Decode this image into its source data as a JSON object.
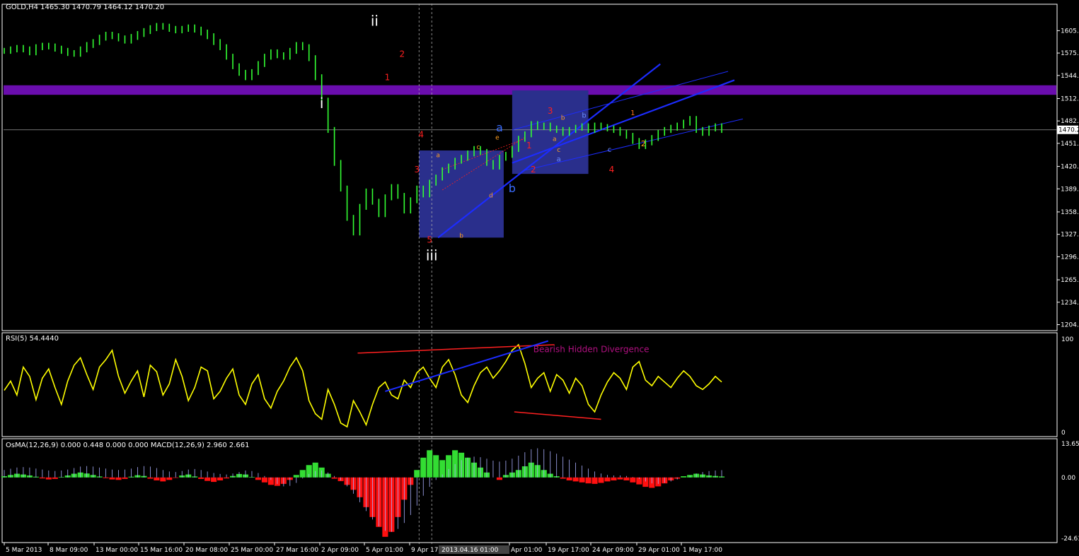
{
  "header": {
    "main": "GOLD,H4  1465.30 1470.79 1464.12 1470.20",
    "rsi": "RSI(5) 54.4440",
    "macd": "OsMA(12,26,9) 0.000 0.448 0.000 0.000  MACD(12,26,9) 2.960 2.661"
  },
  "colors": {
    "background": "#000000",
    "candle": "#33ff33",
    "zone": "#6a0dad",
    "box": "#2a2f8c",
    "channel": "#1c2cff",
    "rsi": "#ffff00",
    "divergence": "#ff2020",
    "divergence_text": "#b01080",
    "hist_up": "#33dd33",
    "hist_down": "#ff1010",
    "macd_line": "#aab0ff"
  },
  "chart_data": [
    {
      "type": "line",
      "panel": "price",
      "title": "GOLD,H4",
      "ohlc_last": {
        "open": 1465.3,
        "high": 1470.79,
        "low": 1464.12,
        "close": 1470.2
      },
      "yticks": [
        1605.6,
        1575.0,
        1544.4,
        1512.9,
        1482.3,
        1451.7,
        1420.2,
        1389.6,
        1358.1,
        1327.5,
        1296.9,
        1265.4,
        1234.8,
        1204.2
      ],
      "ylim": [
        1196,
        1632
      ],
      "current_price": "1470.2",
      "x": [
        0,
        3,
        6,
        9,
        12,
        15,
        18,
        21,
        24,
        27,
        30,
        33,
        36,
        39,
        42,
        45,
        48,
        51,
        54,
        57,
        60,
        63,
        66,
        69,
        72,
        75,
        78,
        81,
        84,
        87,
        90,
        93,
        96,
        99,
        102,
        105,
        108,
        111,
        114,
        117,
        120,
        123,
        126,
        129,
        132,
        135,
        138,
        141,
        144,
        147,
        150,
        153,
        156,
        159,
        162,
        165,
        168,
        171,
        174,
        177,
        180,
        183,
        186,
        189,
        192,
        195,
        198,
        201,
        204,
        207,
        210,
        213,
        216,
        219,
        222,
        225,
        228,
        231,
        234,
        237,
        240,
        243,
        246,
        249,
        252,
        255,
        258,
        261,
        264,
        267,
        270,
        273,
        276,
        279,
        282,
        285,
        288,
        291,
        294,
        297,
        300,
        303,
        306,
        309,
        312,
        315,
        318,
        321,
        324,
        327,
        330,
        333,
        336,
        339
      ],
      "y": [
        1578,
        1580,
        1582,
        1580,
        1576,
        1583,
        1585,
        1584,
        1581,
        1578,
        1575,
        1574,
        1580,
        1586,
        1590,
        1596,
        1600,
        1598,
        1595,
        1592,
        1597,
        1601,
        1605,
        1609,
        1612,
        1611,
        1608,
        1606,
        1608,
        1610,
        1607,
        1603,
        1598,
        1590,
        1583,
        1570,
        1557,
        1548,
        1542,
        1549,
        1560,
        1570,
        1576,
        1572,
        1570,
        1578,
        1586,
        1583,
        1568,
        1542,
        1510,
        1470,
        1425,
        1390,
        1350,
        1330,
        1365,
        1386,
        1372,
        1355,
        1378,
        1392,
        1380,
        1360,
        1374,
        1390,
        1382,
        1398,
        1405,
        1415,
        1420,
        1428,
        1432,
        1438,
        1444,
        1440,
        1425,
        1420,
        1432,
        1436,
        1444,
        1458,
        1464,
        1478,
        1474,
        1476,
        1472,
        1470,
        1466,
        1470,
        1473,
        1475,
        1470,
        1476,
        1474,
        1472,
        1470,
        1466,
        1462,
        1455,
        1448,
        1453,
        1459,
        1466,
        1470,
        1473,
        1476,
        1480,
        1485,
        1470,
        1466,
        1472,
        1475,
        1470
      ],
      "annotations": [
        "i",
        "ii",
        "iii",
        "1",
        "2",
        "3",
        "4",
        "5",
        "a",
        "b",
        "c",
        "d",
        "e"
      ],
      "xticks": [
        "5 Mar 2013",
        "8 Mar 09:00",
        "13 Mar 00:00",
        "15 Mar 16:00",
        "20 Mar 08:00",
        "25 Mar 00:00",
        "27 Mar 16:00",
        "2 Apr 09:00",
        "5 Apr 01:00",
        "9 Apr 17:00",
        "Apr 01:00",
        "19 Apr 17:00",
        "24 Apr 09:00",
        "29 Apr 01:00",
        "1 May 17:00"
      ],
      "cursor_time": "2013.04.16 01:00"
    },
    {
      "type": "line",
      "panel": "rsi",
      "title": "RSI(5) 54.4440",
      "yticks": [
        "100",
        "0"
      ],
      "ylim": [
        0,
        100
      ],
      "x": [
        0,
        3,
        6,
        9,
        12,
        15,
        18,
        21,
        24,
        27,
        30,
        33,
        36,
        39,
        42,
        45,
        48,
        51,
        54,
        57,
        60,
        63,
        66,
        69,
        72,
        75,
        78,
        81,
        84,
        87,
        90,
        93,
        96,
        99,
        102,
        105,
        108,
        111,
        114,
        117,
        120,
        123,
        126,
        129,
        132,
        135,
        138,
        141,
        144,
        147,
        150,
        153,
        156,
        159,
        162,
        165,
        168,
        171,
        174,
        177,
        180,
        183,
        186,
        189,
        192,
        195,
        198,
        201,
        204,
        207,
        210,
        213,
        216,
        219,
        222,
        225,
        228,
        231,
        234,
        237,
        240,
        243,
        246,
        249,
        252,
        255,
        258,
        261,
        264,
        267,
        270,
        273,
        276,
        279,
        282,
        285,
        288,
        291,
        294,
        297,
        300,
        303,
        306,
        309,
        312,
        315,
        318,
        321,
        324,
        327,
        330,
        333,
        336,
        339
      ],
      "values": [
        45,
        55,
        40,
        70,
        60,
        35,
        58,
        68,
        48,
        30,
        55,
        72,
        80,
        62,
        46,
        70,
        78,
        88,
        60,
        42,
        55,
        66,
        38,
        72,
        65,
        40,
        52,
        78,
        60,
        34,
        48,
        70,
        66,
        36,
        44,
        58,
        68,
        40,
        30,
        52,
        62,
        36,
        26,
        44,
        55,
        70,
        80,
        66,
        34,
        20,
        14,
        46,
        30,
        10,
        6,
        34,
        22,
        8,
        30,
        48,
        54,
        40,
        36,
        56,
        48,
        64,
        70,
        58,
        48,
        70,
        78,
        62,
        40,
        32,
        50,
        64,
        70,
        58,
        66,
        76,
        88,
        94,
        74,
        48,
        58,
        64,
        44,
        62,
        56,
        42,
        58,
        50,
        30,
        22,
        40,
        54,
        64,
        58,
        46,
        70,
        76,
        56,
        50,
        60,
        54,
        48,
        58,
        66,
        60,
        50,
        46,
        52,
        60,
        54
      ],
      "divergence_label": "Bearish Hidden Divergence"
    },
    {
      "type": "bar",
      "panel": "macd",
      "title": "OsMA(12,26,9) 0.000 0.448 0.000 0.000  MACD(12,26,9) 2.960 2.661",
      "yticks": [
        "13.655",
        "0.00",
        "-24.618"
      ],
      "ylim": [
        -24.618,
        13.655
      ],
      "osma": [
        0.5,
        1,
        1.5,
        1.2,
        0.8,
        0.3,
        -0.4,
        -0.8,
        -0.6,
        0.2,
        0.8,
        1.5,
        2,
        1.6,
        1,
        0.4,
        -0.3,
        -0.8,
        -1,
        -0.6,
        0.3,
        0.9,
        0.6,
        -0.5,
        -1.2,
        -1.6,
        -1,
        -0.2,
        0.8,
        1.2,
        0.4,
        -0.6,
        -1.4,
        -1.8,
        -1.2,
        -0.4,
        0.6,
        1.4,
        1.2,
        0.2,
        -1,
        -2,
        -3,
        -3.4,
        -2.6,
        -1,
        1,
        3,
        5,
        6,
        4,
        1.5,
        -0.5,
        -1.5,
        -3,
        -5,
        -8,
        -12,
        -16,
        -20,
        -24,
        -22,
        -16,
        -9,
        -3,
        3,
        8,
        11,
        9,
        7,
        9,
        11,
        10,
        8,
        6,
        4,
        2,
        0,
        -1,
        1,
        2,
        3,
        4.5,
        6,
        5,
        3,
        1.5,
        0.5,
        -0.5,
        -1.2,
        -1.6,
        -2,
        -2.4,
        -2.6,
        -2.2,
        -1.6,
        -1.2,
        -0.8,
        -1.2,
        -2,
        -2.8,
        -3.8,
        -4.2,
        -3.6,
        -2.4,
        -1.2,
        -0.5,
        0.5,
        1,
        1.5,
        1.2,
        0.8,
        0.6,
        0.4
      ],
      "macd": [
        3,
        3.5,
        4,
        4.2,
        4,
        3.6,
        3.2,
        2.8,
        2.6,
        2.8,
        3.2,
        3.8,
        4.4,
        4.6,
        4.4,
        4,
        3.6,
        3.2,
        3,
        3.2,
        3.6,
        4.2,
        4.6,
        4.4,
        3.8,
        3,
        2.4,
        2.2,
        2.6,
        3.2,
        3.4,
        3,
        2.4,
        1.8,
        1.4,
        1.2,
        1.6,
        2.2,
        2.8,
        2.6,
        1.8,
        0.6,
        -1,
        -2.6,
        -3.6,
        -3.4,
        -2.2,
        -0.4,
        1.4,
        2.6,
        2.8,
        2,
        0.6,
        -1.2,
        -3.6,
        -6.6,
        -10,
        -13.6,
        -17,
        -19.8,
        -21.6,
        -22,
        -20.8,
        -18.4,
        -15.2,
        -11.4,
        -7.4,
        -3.8,
        -1,
        1.2,
        3.4,
        5.4,
        7,
        8,
        8.4,
        8.2,
        7.6,
        6.8,
        6.4,
        6.8,
        7.6,
        8.8,
        10.2,
        11.4,
        11.8,
        11.4,
        10.6,
        9.6,
        8.4,
        7.2,
        6,
        4.8,
        3.6,
        2.4,
        1.6,
        1,
        0.8,
        0.8,
        0.6,
        0.2,
        -0.6,
        -1.6,
        -2.4,
        -2.6,
        -2.2,
        -1.6,
        -0.8,
        0,
        0.8,
        1.6,
        2.2,
        2.6,
        2.8,
        2.96
      ]
    }
  ]
}
